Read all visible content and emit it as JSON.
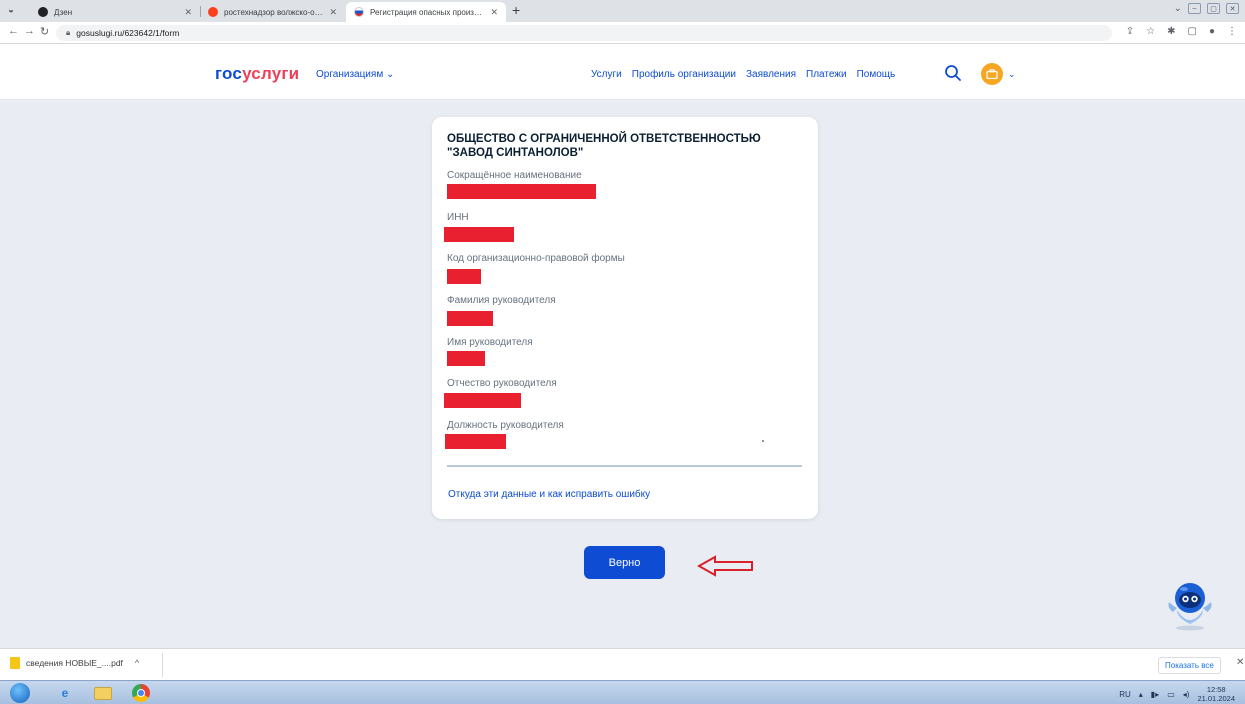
{
  "browser": {
    "tabs": [
      {
        "label": "Дзен",
        "active": false
      },
      {
        "label": "ростехнадзор волжско-окское у",
        "active": false
      },
      {
        "label": "Регистрация опасных производ",
        "active": true
      }
    ],
    "address": "gosuslugi.ru/623642/1/form"
  },
  "header": {
    "logo_part1": "гос",
    "logo_part2": "услуги",
    "org_menu": "Организациям",
    "nav": [
      "Услуги",
      "Профиль организации",
      "Заявления",
      "Платежи",
      "Помощь"
    ]
  },
  "card": {
    "org_name": "ОБЩЕСТВО С ОГРАНИЧЕННОЙ ОТВЕТСТВЕННОСТЬЮ \"ЗАВОД СИНТАНОЛОВ\"",
    "fields": [
      {
        "label": "Сокращённое наименование"
      },
      {
        "label": "ИНН"
      },
      {
        "label": "Код организационно-правовой формы"
      },
      {
        "label": "Фамилия руководителя"
      },
      {
        "label": "Имя руководителя"
      },
      {
        "label": "Отчество руководителя"
      },
      {
        "label": "Должность руководителя"
      }
    ],
    "help_link": "Откуда эти данные и как исправить ошибку"
  },
  "confirm_button": "Верно",
  "download_bar": {
    "file": "сведения НОВЫЕ_....pdf",
    "show_all": "Показать все"
  },
  "taskbar": {
    "lang": "RU",
    "time": "12:58",
    "date": "21.01.2024"
  },
  "colors": {
    "accent": "#0d4cd3",
    "logo_red": "#ee3f58",
    "redaction": "#e8202f",
    "arrow": "#d9202b"
  }
}
